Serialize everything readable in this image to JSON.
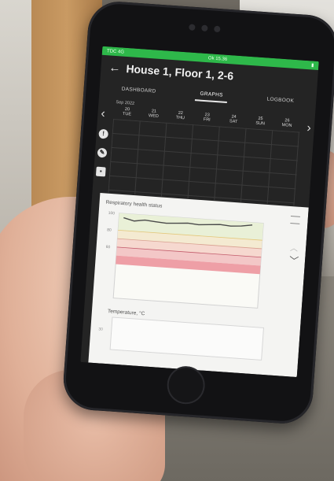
{
  "status_bar": {
    "left": "TDC 4G",
    "center": "Ok 15.36"
  },
  "header": {
    "back_icon": "arrow-left-icon",
    "title": "House 1, Floor 1, 2-6"
  },
  "tabs": [
    {
      "label": "DASHBOARD",
      "active": false
    },
    {
      "label": "GRAPHS",
      "active": true
    },
    {
      "label": "LOGBOOK",
      "active": false
    }
  ],
  "calendar": {
    "month": "Sep 2022",
    "days": [
      {
        "num": "20",
        "name": "TUE"
      },
      {
        "num": "21",
        "name": "WED"
      },
      {
        "num": "22",
        "name": "THU"
      },
      {
        "num": "23",
        "name": "FRI"
      },
      {
        "num": "24",
        "name": "SAT"
      },
      {
        "num": "25",
        "name": "SUN"
      },
      {
        "num": "26",
        "name": "MON"
      }
    ]
  },
  "side_icons": [
    "info-icon",
    "pencil-icon",
    "checkbox-icon"
  ],
  "chart_data": {
    "type": "line",
    "title": "Respiratory health status",
    "ylim": [
      0,
      100
    ],
    "yticks": [
      "100",
      "80",
      "60"
    ],
    "bands": [
      {
        "from": 80,
        "to": 100,
        "color": "#e9f0d7"
      },
      {
        "from": 70,
        "to": 80,
        "color": "#f4ead1"
      },
      {
        "from": 60,
        "to": 70,
        "color": "#f6d8cf"
      },
      {
        "from": 50,
        "to": 60,
        "color": "#f3c7c7"
      },
      {
        "from": 40,
        "to": 50,
        "color": "#ee9fa6"
      }
    ],
    "series": [
      {
        "x": [
          0,
          1,
          2,
          3,
          4,
          5,
          6,
          7,
          8,
          9,
          10,
          11,
          12
        ],
        "values": [
          95,
          92,
          94,
          93,
          92,
          93,
          94,
          93,
          94,
          95,
          94,
          95,
          97
        ],
        "color": "#4a4a4a"
      }
    ]
  },
  "temperature": {
    "title": "Temperature, °C",
    "tick": "30"
  },
  "colors": {
    "status_bar": "#2eb84a",
    "app_bg": "#242424"
  }
}
